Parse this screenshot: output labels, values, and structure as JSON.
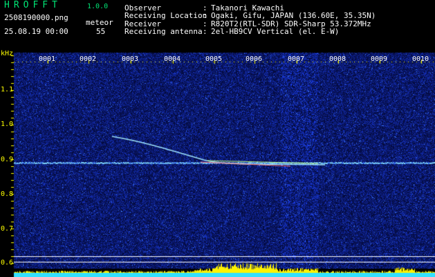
{
  "header": {
    "app_name": "HROFFT",
    "version": "1.0.0",
    "file_name": "2508190000.png",
    "mode_label": "meteor",
    "datetime": "25.08.19 00:00",
    "count": "55"
  },
  "info": {
    "rows": [
      {
        "key": "Observer",
        "value": "Takanori Kawachi"
      },
      {
        "key": "Receiving Location",
        "value": "Ogaki, Gifu, JAPAN (136.60E, 35.35N)"
      },
      {
        "key": "Receiver",
        "value": "R820T2(RTL-SDR) SDR-Sharp 53.372MHz"
      },
      {
        "key": "Receiving antenna",
        "value": "2el-HB9CV Vertical (el. E-W)"
      }
    ]
  },
  "spectrogram": {
    "y_unit": "kHz",
    "y_ticks": [
      "1.1",
      "1.0",
      "0.9",
      "0.8",
      "0.7",
      "0.6"
    ],
    "x_ticks": [
      "0001",
      "0002",
      "0003",
      "0004",
      "0005",
      "0006",
      "0007",
      "0008",
      "0009",
      "0010"
    ],
    "colors": {
      "background": "#000000",
      "noise": "#1a2a8c",
      "axis_tick": "#ffff00",
      "time_label": "#ffffff",
      "guide_line": "#ffffff",
      "carrier": "#7fd7ff",
      "meteor_trail": "#9de3ff",
      "level_fill": "#fff200",
      "level_base": "#33e0ff"
    }
  }
}
